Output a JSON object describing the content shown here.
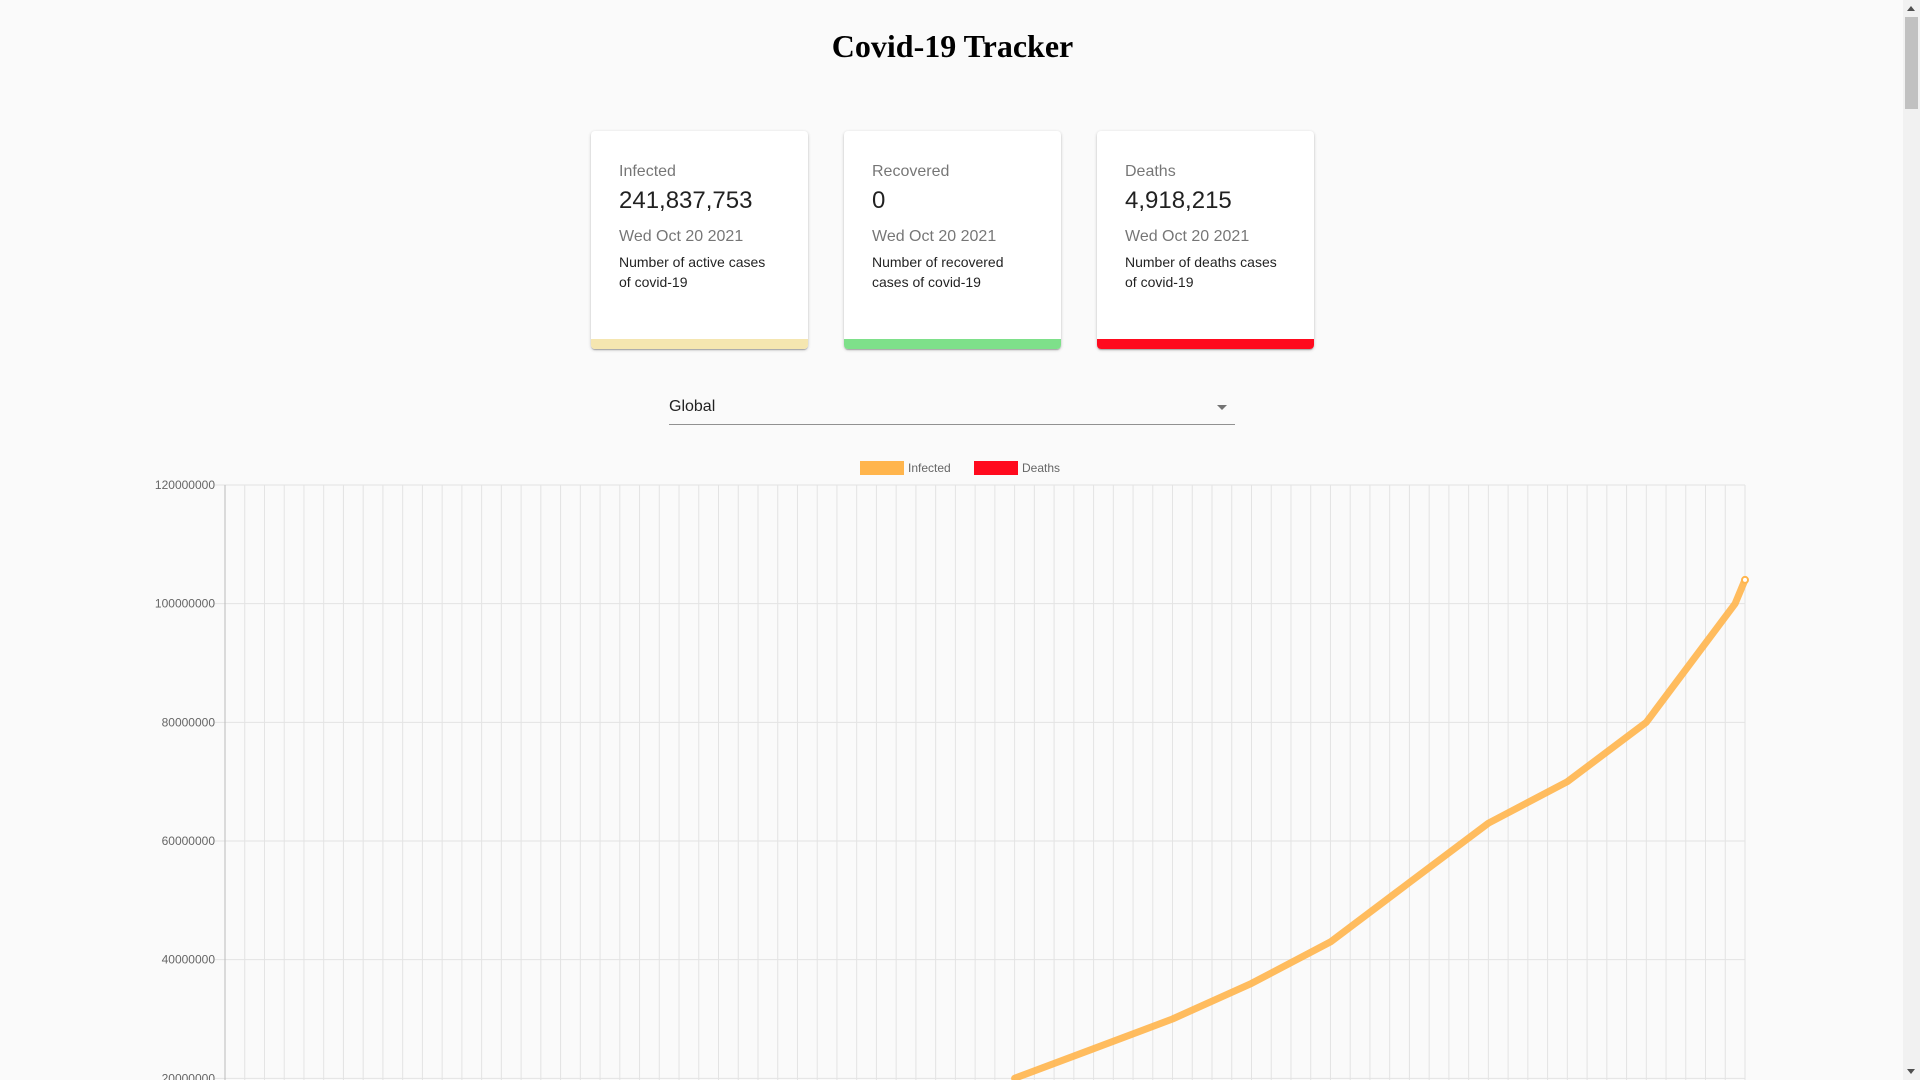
{
  "header": {
    "title": "Covid-19 Tracker"
  },
  "cards": [
    {
      "label": "Infected",
      "value": "241,837,753",
      "date": "Wed Oct 20 2021",
      "description": "Number of active cases of covid-19",
      "color": "#f5e6b0"
    },
    {
      "label": "Recovered",
      "value": "0",
      "date": "Wed Oct 20 2021",
      "description": "Number of recovered cases of covid-19",
      "color": "#7ee08a"
    },
    {
      "label": "Deaths",
      "value": "4,918,215",
      "date": "Wed Oct 20 2021",
      "description": "Number of deaths cases of covid-19",
      "color": "#ff0a1e"
    }
  ],
  "country_select": {
    "selected": "Global"
  },
  "chart_data": {
    "type": "line",
    "legend": [
      {
        "name": "Infected",
        "color": "#ffb54d"
      },
      {
        "name": "Deaths",
        "color": "#ff0a1e"
      }
    ],
    "legend_position": "top-center",
    "grid": true,
    "ylim": [
      0,
      120000000
    ],
    "y_ticks": [
      "120000000",
      "100000000",
      "80000000",
      "60000000",
      "40000000",
      "20000000"
    ],
    "y_tick_values": [
      120000000,
      100000000,
      80000000,
      60000000,
      40000000,
      20000000
    ],
    "x_count": 77,
    "series": [
      {
        "name": "Infected",
        "color": "#ffb54d",
        "x": [
          40,
          44,
          48,
          52,
          56,
          60,
          64,
          68,
          72,
          76.5,
          77
        ],
        "values": [
          20000000,
          25000000,
          30000000,
          36000000,
          43000000,
          53000000,
          63000000,
          70000000,
          80000000,
          100000000,
          104000000
        ]
      }
    ]
  }
}
